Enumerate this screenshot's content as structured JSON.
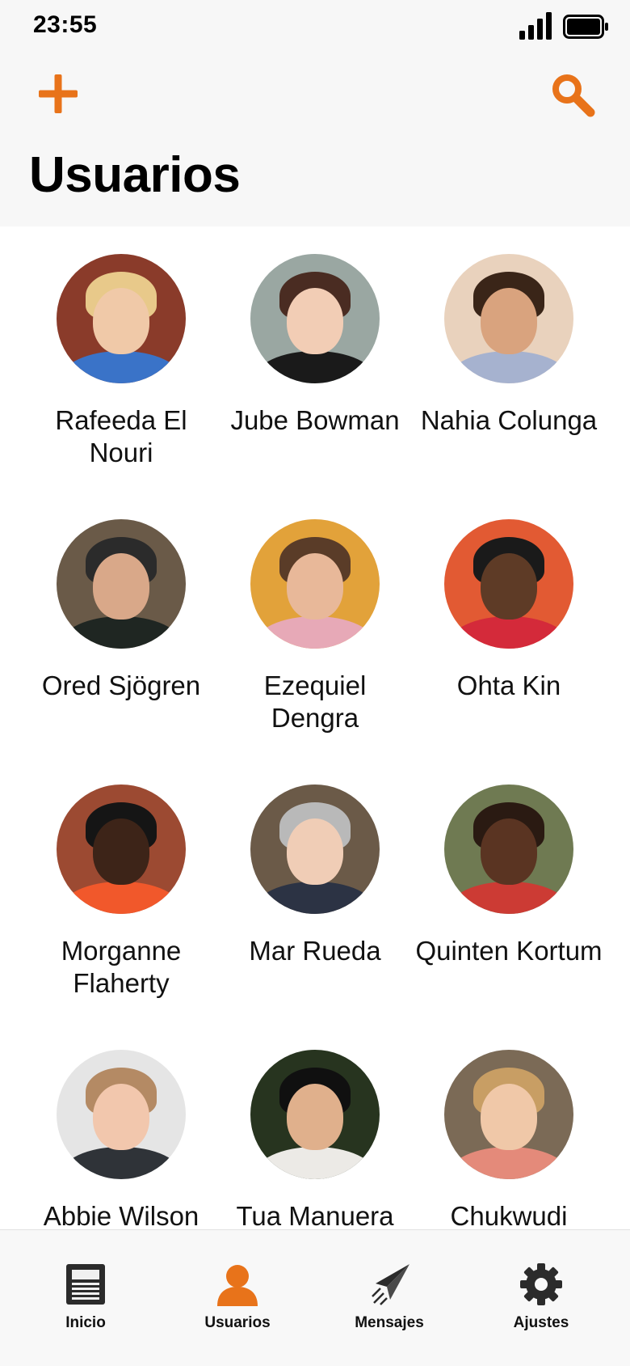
{
  "status_bar": {
    "time": "23:55"
  },
  "header": {
    "title": "Usuarios",
    "add_icon": "plus-icon",
    "search_icon": "search-icon",
    "accent_color": "#e8731a"
  },
  "users": [
    {
      "name": "Rafeeda El Nouri",
      "skin": "#f0c9a8",
      "hair": "#e8c98a",
      "bg": "#8a3b2a",
      "shirt": "#3a73c8"
    },
    {
      "name": "Jube Bowman",
      "skin": "#f2cdb5",
      "hair": "#4a2c22",
      "bg": "#9aa7a2",
      "shirt": "#1a1a1a"
    },
    {
      "name": "Nahia Colunga",
      "skin": "#d9a37e",
      "hair": "#3a2518",
      "bg": "#e9d2bd",
      "shirt": "#a6b2cf"
    },
    {
      "name": "Ored Sjögren",
      "skin": "#d9a889",
      "hair": "#2b2b2b",
      "bg": "#6a5a48",
      "shirt": "#1f2622"
    },
    {
      "name": "Ezequiel Dengra",
      "skin": "#e8b899",
      "hair": "#5a3c28",
      "bg": "#e2a23a",
      "shirt": "#e7a9b7"
    },
    {
      "name": "Ohta Kin",
      "skin": "#5e3b26",
      "hair": "#1a1a1a",
      "bg": "#e25a33",
      "shirt": "#d42a3a"
    },
    {
      "name": "Morganne Flaherty",
      "skin": "#3d2418",
      "hair": "#151515",
      "bg": "#9c4a32",
      "shirt": "#f1582b"
    },
    {
      "name": "Mar Rueda",
      "skin": "#f0cdb6",
      "hair": "#b9b9b9",
      "bg": "#6b5a48",
      "shirt": "#2c3344"
    },
    {
      "name": "Quinten Kortum",
      "skin": "#5a3422",
      "hair": "#2a1a12",
      "bg": "#6f7a52",
      "shirt": "#cc3b34"
    },
    {
      "name": "Abbie Wilson",
      "skin": "#f2c7ad",
      "hair": "#b48a64",
      "bg": "#e5e5e5",
      "shirt": "#2f3338"
    },
    {
      "name": "Tua Manuera",
      "skin": "#e0b08c",
      "hair": "#101010",
      "bg": "#27341f",
      "shirt": "#eceae6"
    },
    {
      "name": "Chukwudi",
      "skin": "#f0c8a8",
      "hair": "#c89e64",
      "bg": "#7b6a56",
      "shirt": "#e48a7a"
    }
  ],
  "tabs": [
    {
      "label": "Inicio",
      "icon": "newspaper-icon"
    },
    {
      "label": "Usuarios",
      "icon": "person-icon",
      "active": true
    },
    {
      "label": "Mensajes",
      "icon": "paper-plane-icon"
    },
    {
      "label": "Ajustes",
      "icon": "gear-icon"
    }
  ]
}
